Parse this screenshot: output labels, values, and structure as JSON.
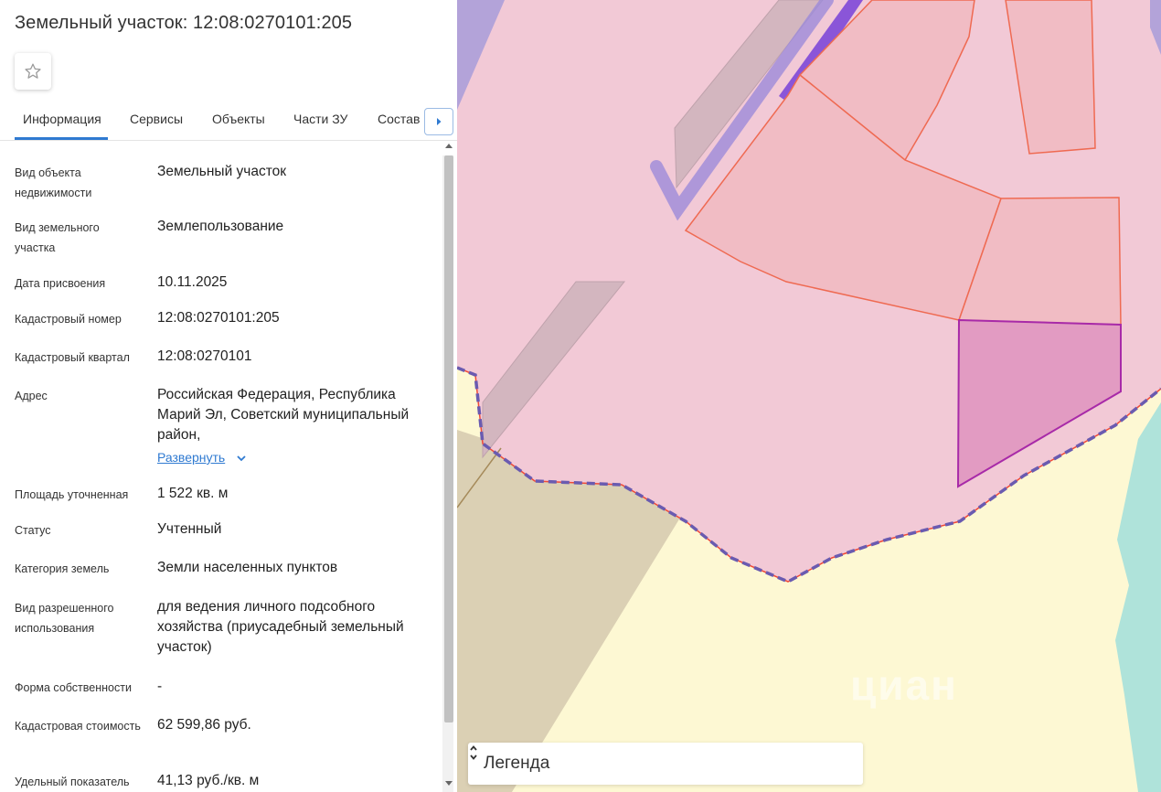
{
  "panel": {
    "title": "Земельный участок: 12:08:0270101:205",
    "tabs": [
      "Информация",
      "Сервисы",
      "Объекты",
      "Части ЗУ",
      "Состав"
    ],
    "active_tab": "Информация",
    "rows": [
      {
        "label": "Вид объекта недвижимости",
        "value": "Земельный участок"
      },
      {
        "label": "Вид земельного участка",
        "value": "Землепользование"
      },
      {
        "label": "Дата присвоения",
        "value": "10.11.2025"
      },
      {
        "label": "Кадастровый номер",
        "value": "12:08:0270101:205"
      },
      {
        "label": "Кадастровый квартал",
        "value": "12:08:0270101"
      },
      {
        "label": "Адрес",
        "value": "Российская Федерация, Республика Марий Эл, Советский муниципальный район,"
      },
      {
        "label": "Площадь уточненная",
        "value": "1 522 кв. м"
      },
      {
        "label": "Статус",
        "value": "Учтенный"
      },
      {
        "label": "Категория земель",
        "value": "Земли населенных пунктов"
      },
      {
        "label": "Вид разрешенного использования",
        "value": "для ведения личного подсобного хозяйства (приусадебный земельный участок)"
      },
      {
        "label": "Форма собственности",
        "value": "-"
      },
      {
        "label": "Кадастровая стоимость",
        "value": "62 599,86 руб."
      },
      {
        "label": "Удельный показатель",
        "value": "41,13 руб./кв. м"
      }
    ],
    "expand_link": "Развернуть"
  },
  "map": {
    "watermark": "циан",
    "legend_label": "Легенда",
    "colors": {
      "zone_pink": "#f2c9d6",
      "parcel_fill": "#f1bcc4",
      "parcel_stroke": "#ef6a52",
      "selected_fill": "#e29bc2",
      "selected_stroke": "#a82aa8",
      "yellow": "#fdf8d3",
      "tan": "#dbd0b4",
      "teal": "#afe3da",
      "purple": "#b3a3d9",
      "boundary_dash": "#6a5bb0"
    }
  },
  "icons": {
    "favorite": "star-outline-icon",
    "tab_next": "caret-right-icon",
    "expand": "chevron-down-icon",
    "legend_toggle": "up-down-chevron-icon"
  }
}
